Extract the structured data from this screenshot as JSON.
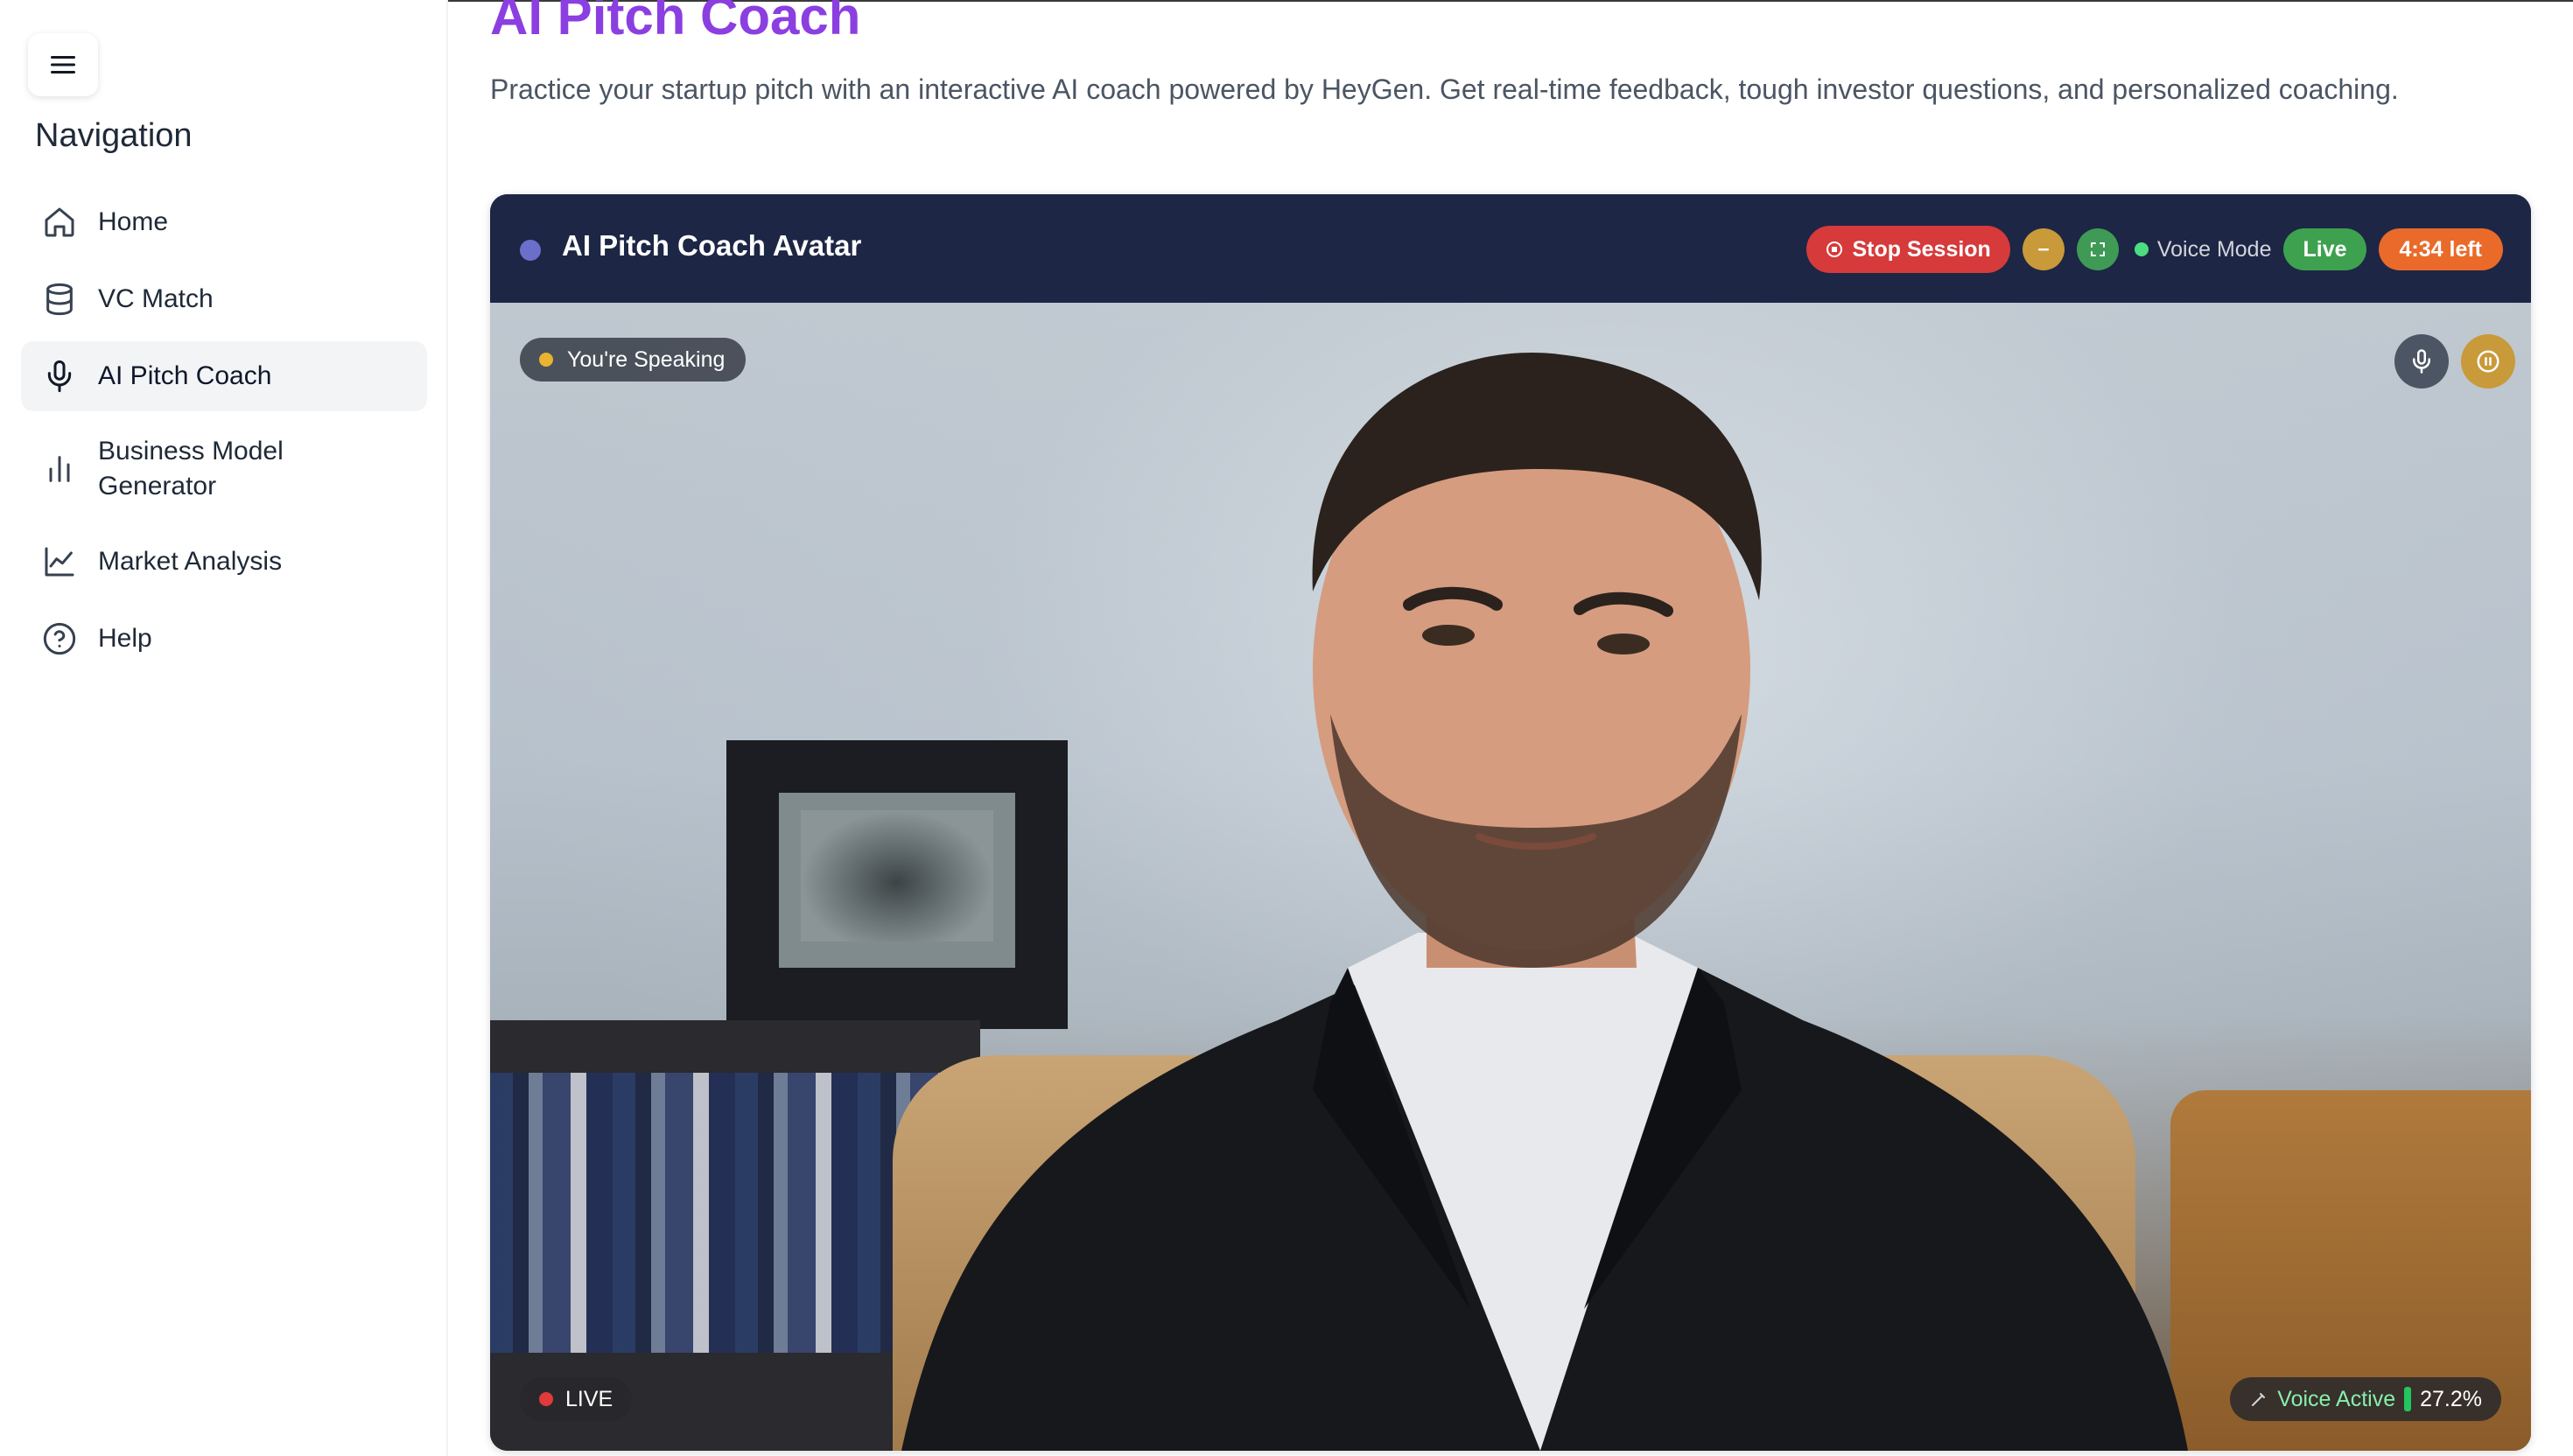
{
  "sidebar": {
    "title": "Navigation",
    "items": [
      {
        "label": "Home",
        "icon": "home-icon",
        "active": false
      },
      {
        "label": "VC Match",
        "icon": "database-icon",
        "active": false
      },
      {
        "label": "AI Pitch Coach",
        "icon": "microphone-icon",
        "active": true
      },
      {
        "label": "Business Model Generator",
        "icon": "bar-chart-icon",
        "active": false
      },
      {
        "label": "Market Analysis",
        "icon": "line-chart-icon",
        "active": false
      },
      {
        "label": "Help",
        "icon": "help-circle-icon",
        "active": false
      }
    ]
  },
  "page": {
    "title": "AI Pitch Coach",
    "subtitle": "Practice your startup pitch with an interactive AI coach powered by HeyGen. Get real-time feedback, tough investor questions, and personalized coaching."
  },
  "session": {
    "title": "AI Pitch Coach Avatar",
    "stop_label": "Stop Session",
    "voice_mode_label": "Voice Mode",
    "live_label": "Live",
    "time_left": "4:34 left",
    "speaking_label": "You're Speaking",
    "live_badge": "LIVE",
    "voice_active_label": "Voice Active",
    "voice_level": "27.2%"
  },
  "colors": {
    "accent": "#8b3fe0",
    "header_bg": "#1d2645",
    "stop": "#d63a3a",
    "live": "#3ea14f",
    "time": "#ea6a2a"
  }
}
